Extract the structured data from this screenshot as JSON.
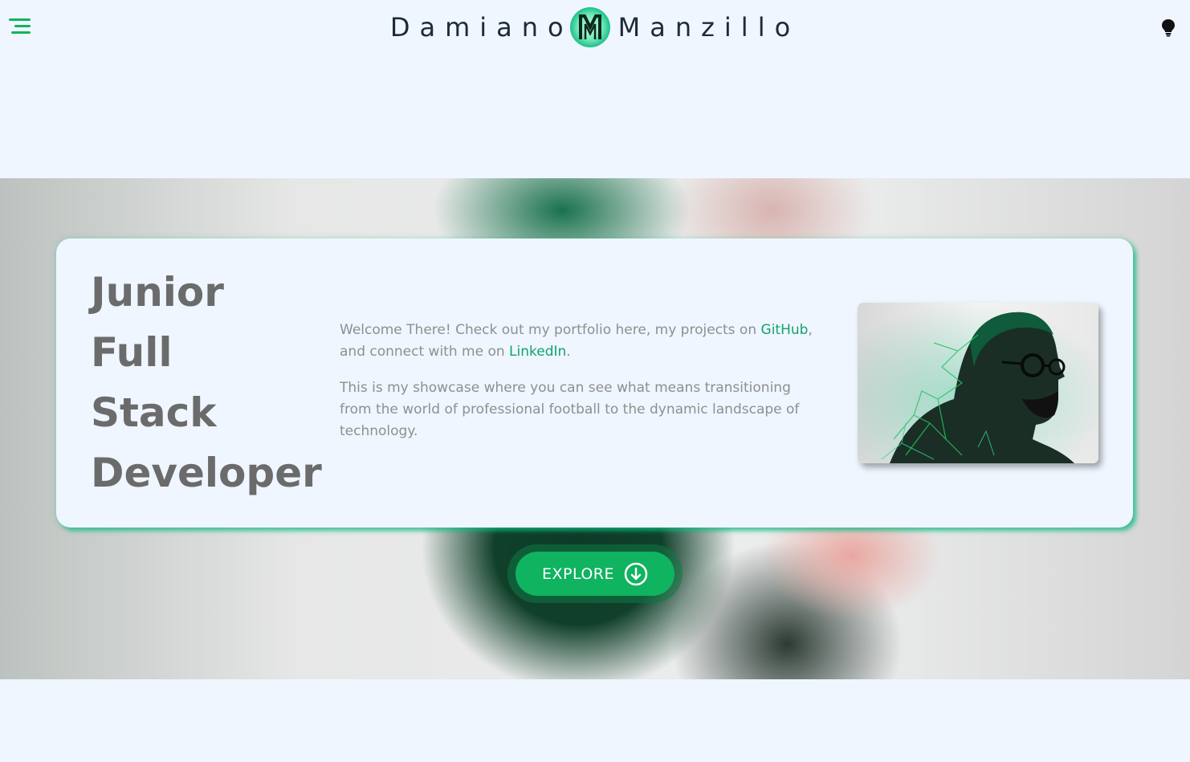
{
  "header": {
    "menu_icon": "menu-icon",
    "brand_first": "Damiano",
    "brand_last": "Manzillo",
    "brand_logo_letter": "M",
    "theme_icon": "lightbulb-icon"
  },
  "hero": {
    "role_lines": [
      "Junior",
      "Full",
      "Stack",
      "Developer"
    ],
    "intro": {
      "p1_before": "Welcome There! Check out my portfolio here, my projects on ",
      "github_link": "GitHub",
      "p1_middle": ", and connect with me on ",
      "linkedin_link": "LinkedIn",
      "p1_after": ".",
      "p2": "This is my showcase where you can see what means transitioning from the world of professional football to the dynamic landscape of technology."
    },
    "explore_label": "EXPLORE",
    "explore_icon": "arrow-down-circle-icon"
  },
  "colors": {
    "accent": "#10b35f",
    "link": "#10a36b",
    "page_bg": "#eff6ff",
    "title_text": "#6b6b6b",
    "body_text": "#8f8f8f"
  }
}
